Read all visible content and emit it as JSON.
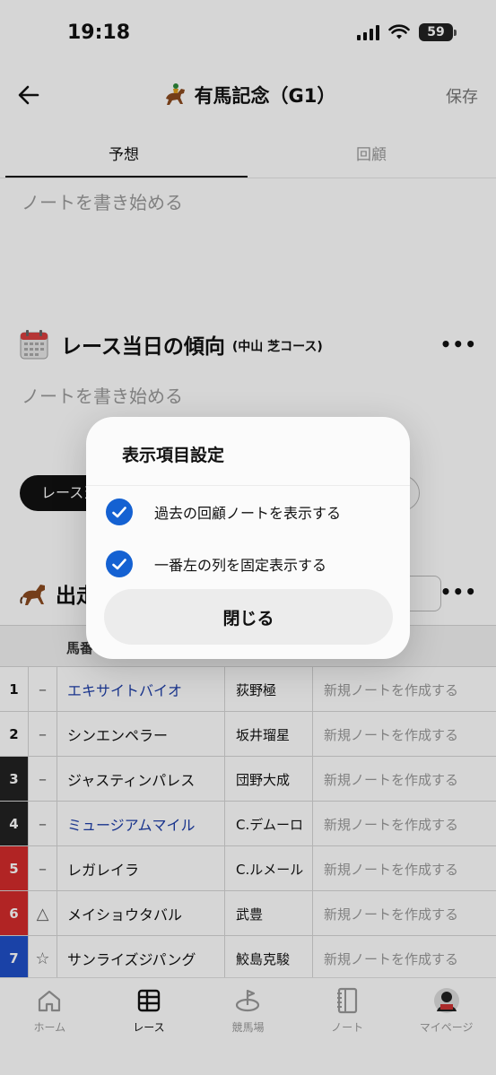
{
  "status": {
    "time": "19:18",
    "battery": "59"
  },
  "header": {
    "title": "有馬記念（G1）",
    "save_label": "保存"
  },
  "tabs": [
    {
      "label": "予想"
    },
    {
      "label": "回顧"
    }
  ],
  "notes": {
    "placeholder_top": "ノートを書き始める",
    "placeholder_trend": "ノートを書き始める"
  },
  "trend": {
    "title": "レース当日の傾向",
    "subtitle": "(中山 芝コース)",
    "more": "•••"
  },
  "chip": {
    "label": "レース当"
  },
  "entries": {
    "title": "出走",
    "more": "•••"
  },
  "table": {
    "header": {
      "number": "馬番"
    },
    "rows": [
      {
        "num": "1",
        "mark": "–",
        "horse": "エキサイトバイオ",
        "jockey": "荻野極",
        "note": "新規ノートを作成する",
        "frame_color": "#ffffff",
        "num_color": "#111111",
        "link": true
      },
      {
        "num": "2",
        "mark": "–",
        "horse": "シンエンペラー",
        "jockey": "坂井瑠星",
        "note": "新規ノートを作成する",
        "frame_color": "#ffffff",
        "num_color": "#111111",
        "link": false
      },
      {
        "num": "3",
        "mark": "–",
        "horse": "ジャスティンパレス",
        "jockey": "団野大成",
        "note": "新規ノートを作成する",
        "frame_color": "#222222",
        "num_color": "#ffffff",
        "link": false
      },
      {
        "num": "4",
        "mark": "–",
        "horse": "ミュージアムマイル",
        "jockey": "C.デムーロ",
        "note": "新規ノートを作成する",
        "frame_color": "#222222",
        "num_color": "#ffffff",
        "link": true
      },
      {
        "num": "5",
        "mark": "–",
        "horse": "レガレイラ",
        "jockey": "C.ルメール",
        "note": "新規ノートを作成する",
        "frame_color": "#d32b2b",
        "num_color": "#ffffff",
        "link": false
      },
      {
        "num": "6",
        "mark": "△",
        "horse": "メイショウタバル",
        "jockey": "武豊",
        "note": "新規ノートを作成する",
        "frame_color": "#d32b2b",
        "num_color": "#ffffff",
        "link": false
      },
      {
        "num": "7",
        "mark": "☆",
        "horse": "サンライズジパング",
        "jockey": "鮫島克駿",
        "note": "新規ノートを作成する",
        "frame_color": "#1f4fc8",
        "num_color": "#ffffff",
        "link": false
      }
    ]
  },
  "tabbar": [
    {
      "label": "ホーム",
      "icon": "home-icon",
      "active": false
    },
    {
      "label": "レース",
      "icon": "race-table-icon",
      "active": true
    },
    {
      "label": "競馬場",
      "icon": "racecourse-icon",
      "active": false
    },
    {
      "label": "ノート",
      "icon": "notebook-icon",
      "active": false
    },
    {
      "label": "マイページ",
      "icon": "avatar-icon",
      "active": false
    }
  ],
  "modal": {
    "title": "表示項目設定",
    "options": [
      {
        "label": "過去の回顧ノートを表示する",
        "checked": true
      },
      {
        "label": "一番左の列を固定表示する",
        "checked": true
      }
    ],
    "close_label": "閉じる"
  },
  "colors": {
    "accent": "#1461d2",
    "link": "#1e3fa8"
  }
}
